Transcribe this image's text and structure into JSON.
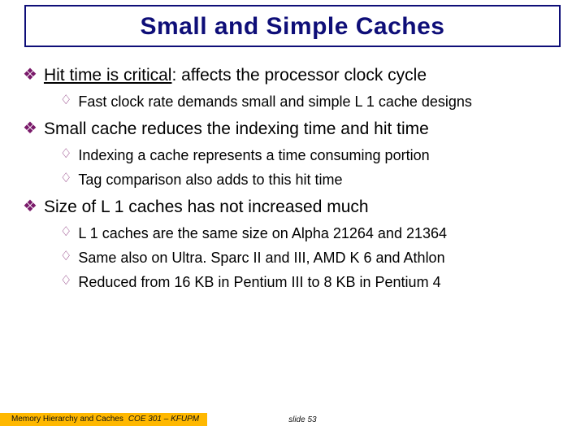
{
  "title": "Small and Simple Caches",
  "bullets": [
    {
      "underlined": "Hit time is critical",
      "rest": ": affects the processor clock cycle",
      "sub": [
        "Fast clock rate demands small and simple L 1 cache designs"
      ]
    },
    {
      "text": "Small cache reduces the indexing time and hit time",
      "sub": [
        "Indexing a cache represents a time consuming portion",
        "Tag comparison also adds to this hit time"
      ]
    },
    {
      "text": "Size of L 1 caches has not increased much",
      "sub": [
        "L 1 caches are the same size on Alpha 21264 and 21364",
        "Same also on Ultra. Sparc II and III, AMD K 6 and Athlon",
        "Reduced from 16 KB in Pentium III to 8 KB in Pentium 4"
      ]
    }
  ],
  "footer": {
    "left": "Memory Hierarchy and Caches",
    "course": "COE 301 – KFUPM",
    "slide": "slide 53"
  },
  "glyphs": {
    "lvl1": "❖",
    "lvl2": "♢"
  }
}
